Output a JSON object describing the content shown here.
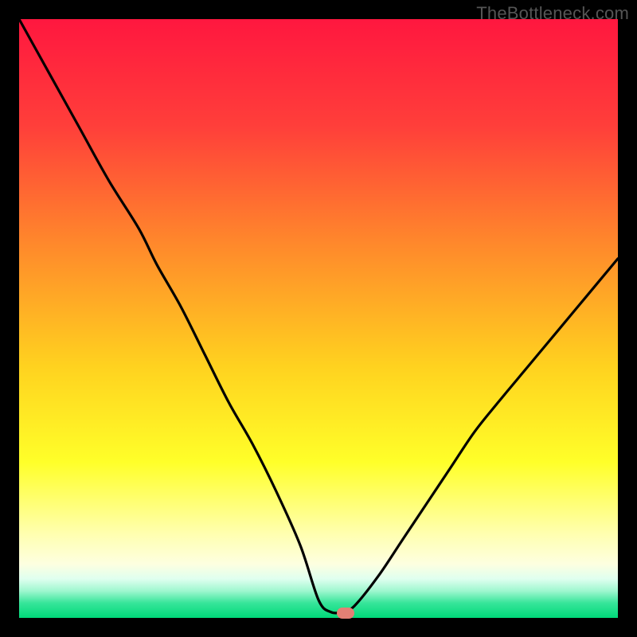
{
  "watermark": "TheBottleneck.com",
  "colors": {
    "frame": "#000000",
    "watermark": "#555555",
    "curve": "#000000",
    "marker": "#e48075",
    "gradient_stops": [
      {
        "offset": 0.0,
        "color": "#ff173f"
      },
      {
        "offset": 0.18,
        "color": "#ff3f3a"
      },
      {
        "offset": 0.38,
        "color": "#ff8a2b"
      },
      {
        "offset": 0.58,
        "color": "#ffd21f"
      },
      {
        "offset": 0.74,
        "color": "#ffff29"
      },
      {
        "offset": 0.86,
        "color": "#ffffb0"
      },
      {
        "offset": 0.91,
        "color": "#fdffe0"
      },
      {
        "offset": 0.935,
        "color": "#dfffef"
      },
      {
        "offset": 0.955,
        "color": "#9ef7cf"
      },
      {
        "offset": 0.975,
        "color": "#37e59a"
      },
      {
        "offset": 1.0,
        "color": "#00d979"
      }
    ]
  },
  "chart_data": {
    "type": "line",
    "title": "",
    "xlabel": "",
    "ylabel": "",
    "xlim": [
      0,
      1
    ],
    "ylim": [
      0,
      1
    ],
    "grid": false,
    "legend": false,
    "series": [
      {
        "name": "bottleneck-curve",
        "x": [
          0.0,
          0.05,
          0.1,
          0.15,
          0.2,
          0.23,
          0.27,
          0.31,
          0.35,
          0.39,
          0.43,
          0.47,
          0.5,
          0.52,
          0.54,
          0.56,
          0.6,
          0.64,
          0.68,
          0.72,
          0.76,
          0.8,
          0.85,
          0.9,
          0.95,
          1.0
        ],
        "y": [
          1.0,
          0.91,
          0.82,
          0.73,
          0.65,
          0.59,
          0.52,
          0.44,
          0.36,
          0.29,
          0.21,
          0.12,
          0.03,
          0.01,
          0.01,
          0.02,
          0.07,
          0.13,
          0.19,
          0.25,
          0.31,
          0.36,
          0.42,
          0.48,
          0.54,
          0.6
        ]
      }
    ],
    "marker": {
      "x": 0.545,
      "y": 0.008
    },
    "annotations": []
  }
}
